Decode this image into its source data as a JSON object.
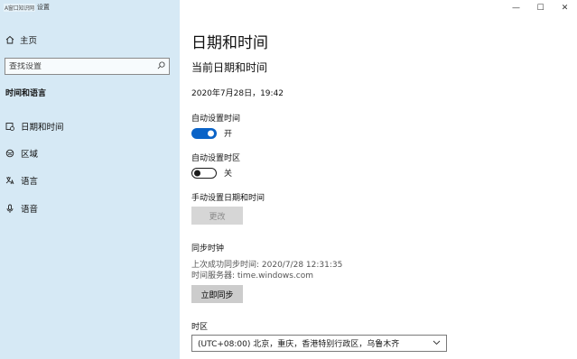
{
  "window": {
    "app_title": "设置",
    "watermark": "A窗口知识网",
    "controls": {
      "minimize": "—",
      "maximize": "☐",
      "close": "✕"
    }
  },
  "sidebar": {
    "home_label": "主页",
    "search_placeholder": "查找设置",
    "section_title": "时间和语言",
    "items": [
      {
        "label": "日期和时间",
        "icon": "calendar-clock-icon"
      },
      {
        "label": "区域",
        "icon": "globe-region-icon"
      },
      {
        "label": "语言",
        "icon": "language-icon"
      },
      {
        "label": "语音",
        "icon": "microphone-icon"
      }
    ]
  },
  "main": {
    "page_title": "日期和时间",
    "sub_title": "当前日期和时间",
    "current_datetime": "2020年7月28日，19:42",
    "auto_time": {
      "label": "自动设置时间",
      "state": "开",
      "on": true
    },
    "auto_timezone": {
      "label": "自动设置时区",
      "state": "关",
      "on": false
    },
    "manual": {
      "label": "手动设置日期和时间",
      "button": "更改"
    },
    "sync": {
      "label": "同步时钟",
      "last_sync": "上次成功同步时间: 2020/7/28 12:31:35",
      "server": "时间服务器: time.windows.com",
      "button": "立即同步"
    },
    "timezone": {
      "label": "时区",
      "value": "(UTC+08:00) 北京，重庆，香港特别行政区，乌鲁木齐"
    }
  },
  "colors": {
    "sidebar_bg": "#d6e9f5",
    "accent": "#0a63c7"
  }
}
